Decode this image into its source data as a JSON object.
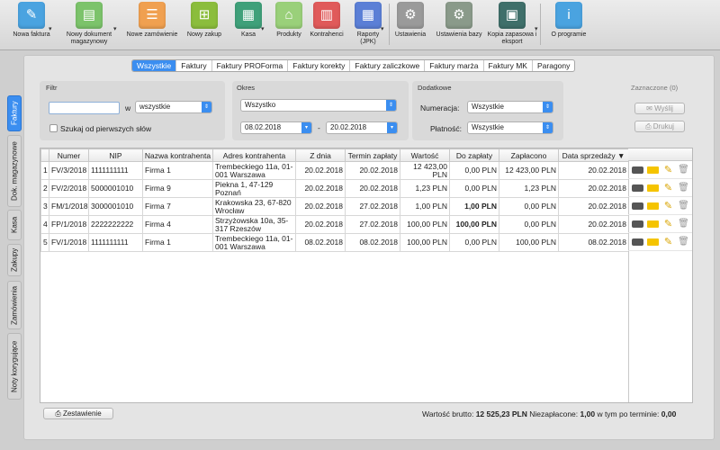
{
  "toolbar": {
    "items": [
      {
        "label": "Nowa faktura",
        "icon": "new-invoice-icon",
        "color": "#4aa3e0",
        "glyph": "✎",
        "dropdown": true
      },
      {
        "label": "Nowy dokument magazynowy",
        "icon": "warehouse-doc-icon",
        "color": "#7cc36b",
        "glyph": "▤",
        "dropdown": true
      },
      {
        "label": "Nowe zamówienie",
        "icon": "new-order-icon",
        "color": "#f0a050",
        "glyph": "☰",
        "dropdown": false
      },
      {
        "label": "Nowy zakup",
        "icon": "new-purchase-icon",
        "color": "#8bbd3c",
        "glyph": "⊞",
        "dropdown": false
      },
      {
        "label": "Kasa",
        "icon": "cash-register-icon",
        "color": "#3fa07a",
        "glyph": "▦",
        "dropdown": true
      },
      {
        "label": "Produkty",
        "icon": "products-icon",
        "color": "#9ad07a",
        "glyph": "⌂",
        "dropdown": false
      },
      {
        "label": "Kontrahenci",
        "icon": "contractors-icon",
        "color": "#e05a5a",
        "glyph": "▥",
        "dropdown": false
      },
      {
        "label": "Raporty (JPK)",
        "icon": "reports-icon",
        "color": "#5b7fd6",
        "glyph": "▦",
        "dropdown": true
      },
      {
        "label": "Ustawienia",
        "icon": "settings-icon",
        "color": "#9a9a9a",
        "glyph": "⚙",
        "dropdown": false
      },
      {
        "label": "Ustawienia bazy",
        "icon": "database-settings-icon",
        "color": "#8a9a8a",
        "glyph": "⚙",
        "dropdown": false
      },
      {
        "label": "Kopia zapasowa i eksport",
        "icon": "backup-icon",
        "color": "#3f6f6a",
        "glyph": "▣",
        "dropdown": true
      },
      {
        "label": "O programie",
        "icon": "info-icon",
        "color": "#4aa3e0",
        "glyph": "i",
        "dropdown": false
      }
    ]
  },
  "side_tabs": [
    "Faktury",
    "Dok. magazynowe",
    "Kasa",
    "Zakupy",
    "Zamówienia",
    "Noty korygujące"
  ],
  "doc_tabs": [
    "Wszystkie",
    "Faktury",
    "Faktury PROForma",
    "Faktury korekty",
    "Faktury zaliczkowe",
    "Faktury marża",
    "Faktury MK",
    "Paragony"
  ],
  "filter": {
    "title": "Filtr",
    "search_value": "",
    "in_label": "w",
    "in_select": "wszystkie",
    "first_words_label": "Szukaj od pierwszych słów"
  },
  "period": {
    "title": "Okres",
    "range": "Wszystko",
    "from": "08.02.2018",
    "dash": "-",
    "to": "20.02.2018"
  },
  "extra": {
    "title": "Dodatkowe",
    "numbering_label": "Numeracja:",
    "numbering_value": "Wszystkie",
    "payment_label": "Płatność:",
    "payment_value": "Wszystkie"
  },
  "selected": {
    "title": "Zaznaczone (0)",
    "send": "Wyślij",
    "print": "Drukuj"
  },
  "table": {
    "headers": [
      "",
      "Numer",
      "NIP",
      "Nazwa kontrahenta",
      "Adres kontrahenta",
      "Z dnia",
      "Termin zapłaty",
      "Wartość",
      "Do zapłaty",
      "Zapłacono",
      "Data sprzedaży ▼"
    ],
    "rows": [
      {
        "idx": "1",
        "numer": "FV/3/2018",
        "nip": "1111111111",
        "nazwa": "Firma 1",
        "adres": "Trembeckiego 11a, 01-001 Warszawa",
        "zdnia": "20.02.2018",
        "termin": "20.02.2018",
        "wartosc": "12 423,00 PLN",
        "dozaplaty": "0,00 PLN",
        "zaplacono": "12 423,00 PLN",
        "data": "20.02.2018",
        "bold": false
      },
      {
        "idx": "2",
        "numer": "FV/2/2018",
        "nip": "5000001010",
        "nazwa": "Firma 9",
        "adres": "Piekna 1, 47-129 Poznań",
        "zdnia": "20.02.2018",
        "termin": "20.02.2018",
        "wartosc": "1,23 PLN",
        "dozaplaty": "0,00 PLN",
        "zaplacono": "1,23 PLN",
        "data": "20.02.2018",
        "bold": false
      },
      {
        "idx": "3",
        "numer": "FM/1/2018",
        "nip": "3000001010",
        "nazwa": "Firma 7",
        "adres": "Krakowska 23, 67-820 Wrocław",
        "zdnia": "20.02.2018",
        "termin": "27.02.2018",
        "wartosc": "1,00 PLN",
        "dozaplaty": "1,00 PLN",
        "zaplacono": "0,00 PLN",
        "data": "20.02.2018",
        "bold": true
      },
      {
        "idx": "4",
        "numer": "FP/1/2018",
        "nip": "2222222222",
        "nazwa": "Firma 4",
        "adres": "Strzyżowska 10a, 35-317 Rzeszów",
        "zdnia": "20.02.2018",
        "termin": "27.02.2018",
        "wartosc": "100,00 PLN",
        "dozaplaty": "100,00 PLN",
        "zaplacono": "0,00 PLN",
        "data": "20.02.2018",
        "bold": true
      },
      {
        "idx": "5",
        "numer": "FV/1/2018",
        "nip": "1111111111",
        "nazwa": "Firma 1",
        "adres": "Trembeckiego 11a, 01-001 Warszawa",
        "zdnia": "08.02.2018",
        "termin": "08.02.2018",
        "wartosc": "100,00 PLN",
        "dozaplaty": "0,00 PLN",
        "zaplacono": "100,00 PLN",
        "data": "08.02.2018",
        "bold": false
      }
    ]
  },
  "footer": {
    "zestawienie": "Zestawienie",
    "gross_label": "Wartość brutto:",
    "gross_value": "12 525,23 PLN",
    "unpaid_label": "Niezapłacone:",
    "unpaid_value": "1,00",
    "overdue_label": "w tym po terminie:",
    "overdue_value": "0,00"
  }
}
